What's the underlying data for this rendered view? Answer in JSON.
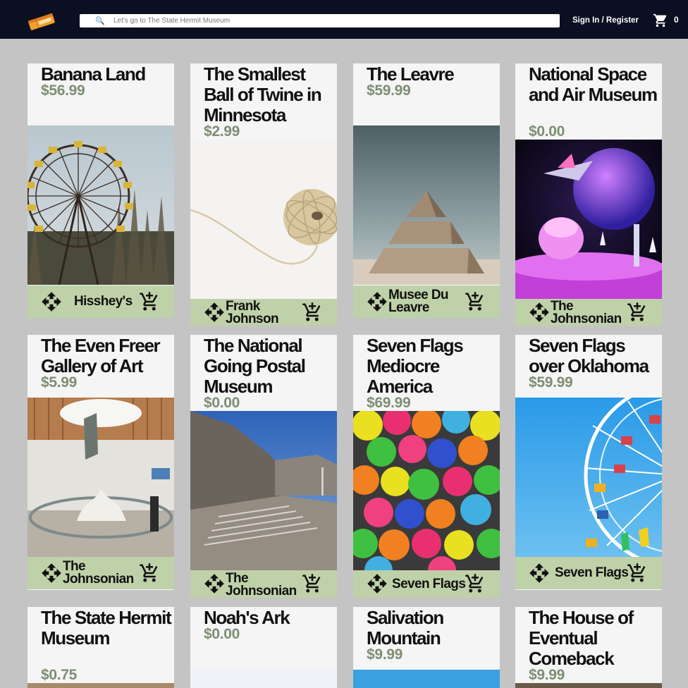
{
  "header": {
    "search_placeholder": "Let's go to The State Hermit Museum",
    "signin_label": "Sign In / Register",
    "cart_count": "0",
    "icons": [
      "ticket-logo-icon",
      "search-icon",
      "cart-icon"
    ]
  },
  "cards": [
    {
      "title": "Banana Land",
      "price": "$56.99",
      "vendor": "Hisshey's",
      "image": "ferris-wheel-forest"
    },
    {
      "title": "The Smallest Ball of Twine in Minnesota",
      "price": "$2.99",
      "vendor": "Frank Johnson",
      "image": "twine-ball"
    },
    {
      "title": "The Leavre",
      "price": "$59.99",
      "vendor": "Musee Du Leavre",
      "image": "stacked-pyramid"
    },
    {
      "title": "National Space and Air Museum",
      "price": "$0.00",
      "vendor": "The Johnsonian",
      "image": "space-model"
    },
    {
      "title": "The Even Freer Gallery of Art",
      "price": "$5.99",
      "vendor": "The Johnsonian",
      "image": "gallery-interior"
    },
    {
      "title": "The National Going Postal Museum",
      "price": "$0.00",
      "vendor": "The Johnsonian",
      "image": "concrete-building-steps"
    },
    {
      "title": "Seven Flags Mediocre America",
      "price": "$69.99",
      "vendor": "Seven Flags",
      "image": "ball-pit"
    },
    {
      "title": "Seven Flags over Oklahoma",
      "price": "$59.99",
      "vendor": "Seven Flags",
      "image": "ferris-wheel-sky"
    },
    {
      "title": "The State Hermit Museum",
      "price": "$0.75",
      "vendor": "",
      "image": ""
    },
    {
      "title": "Noah's Ark",
      "price": "$0.00",
      "vendor": "",
      "image": ""
    },
    {
      "title": "Salivation Mountain",
      "price": "$9.99",
      "vendor": "",
      "image": ""
    },
    {
      "title": "The House of Eventual Comeback",
      "price": "$9.99",
      "vendor": "",
      "image": ""
    }
  ],
  "colors": {
    "header_bg": "#0a0f21",
    "page_bg": "#c4c4c4",
    "card_bg": "#f5f5f5",
    "footer_bg": "#bfd1a8",
    "price": "#7d8e72"
  },
  "footer_icons": [
    "move-arrows-icon",
    "add-to-cart-icon"
  ]
}
